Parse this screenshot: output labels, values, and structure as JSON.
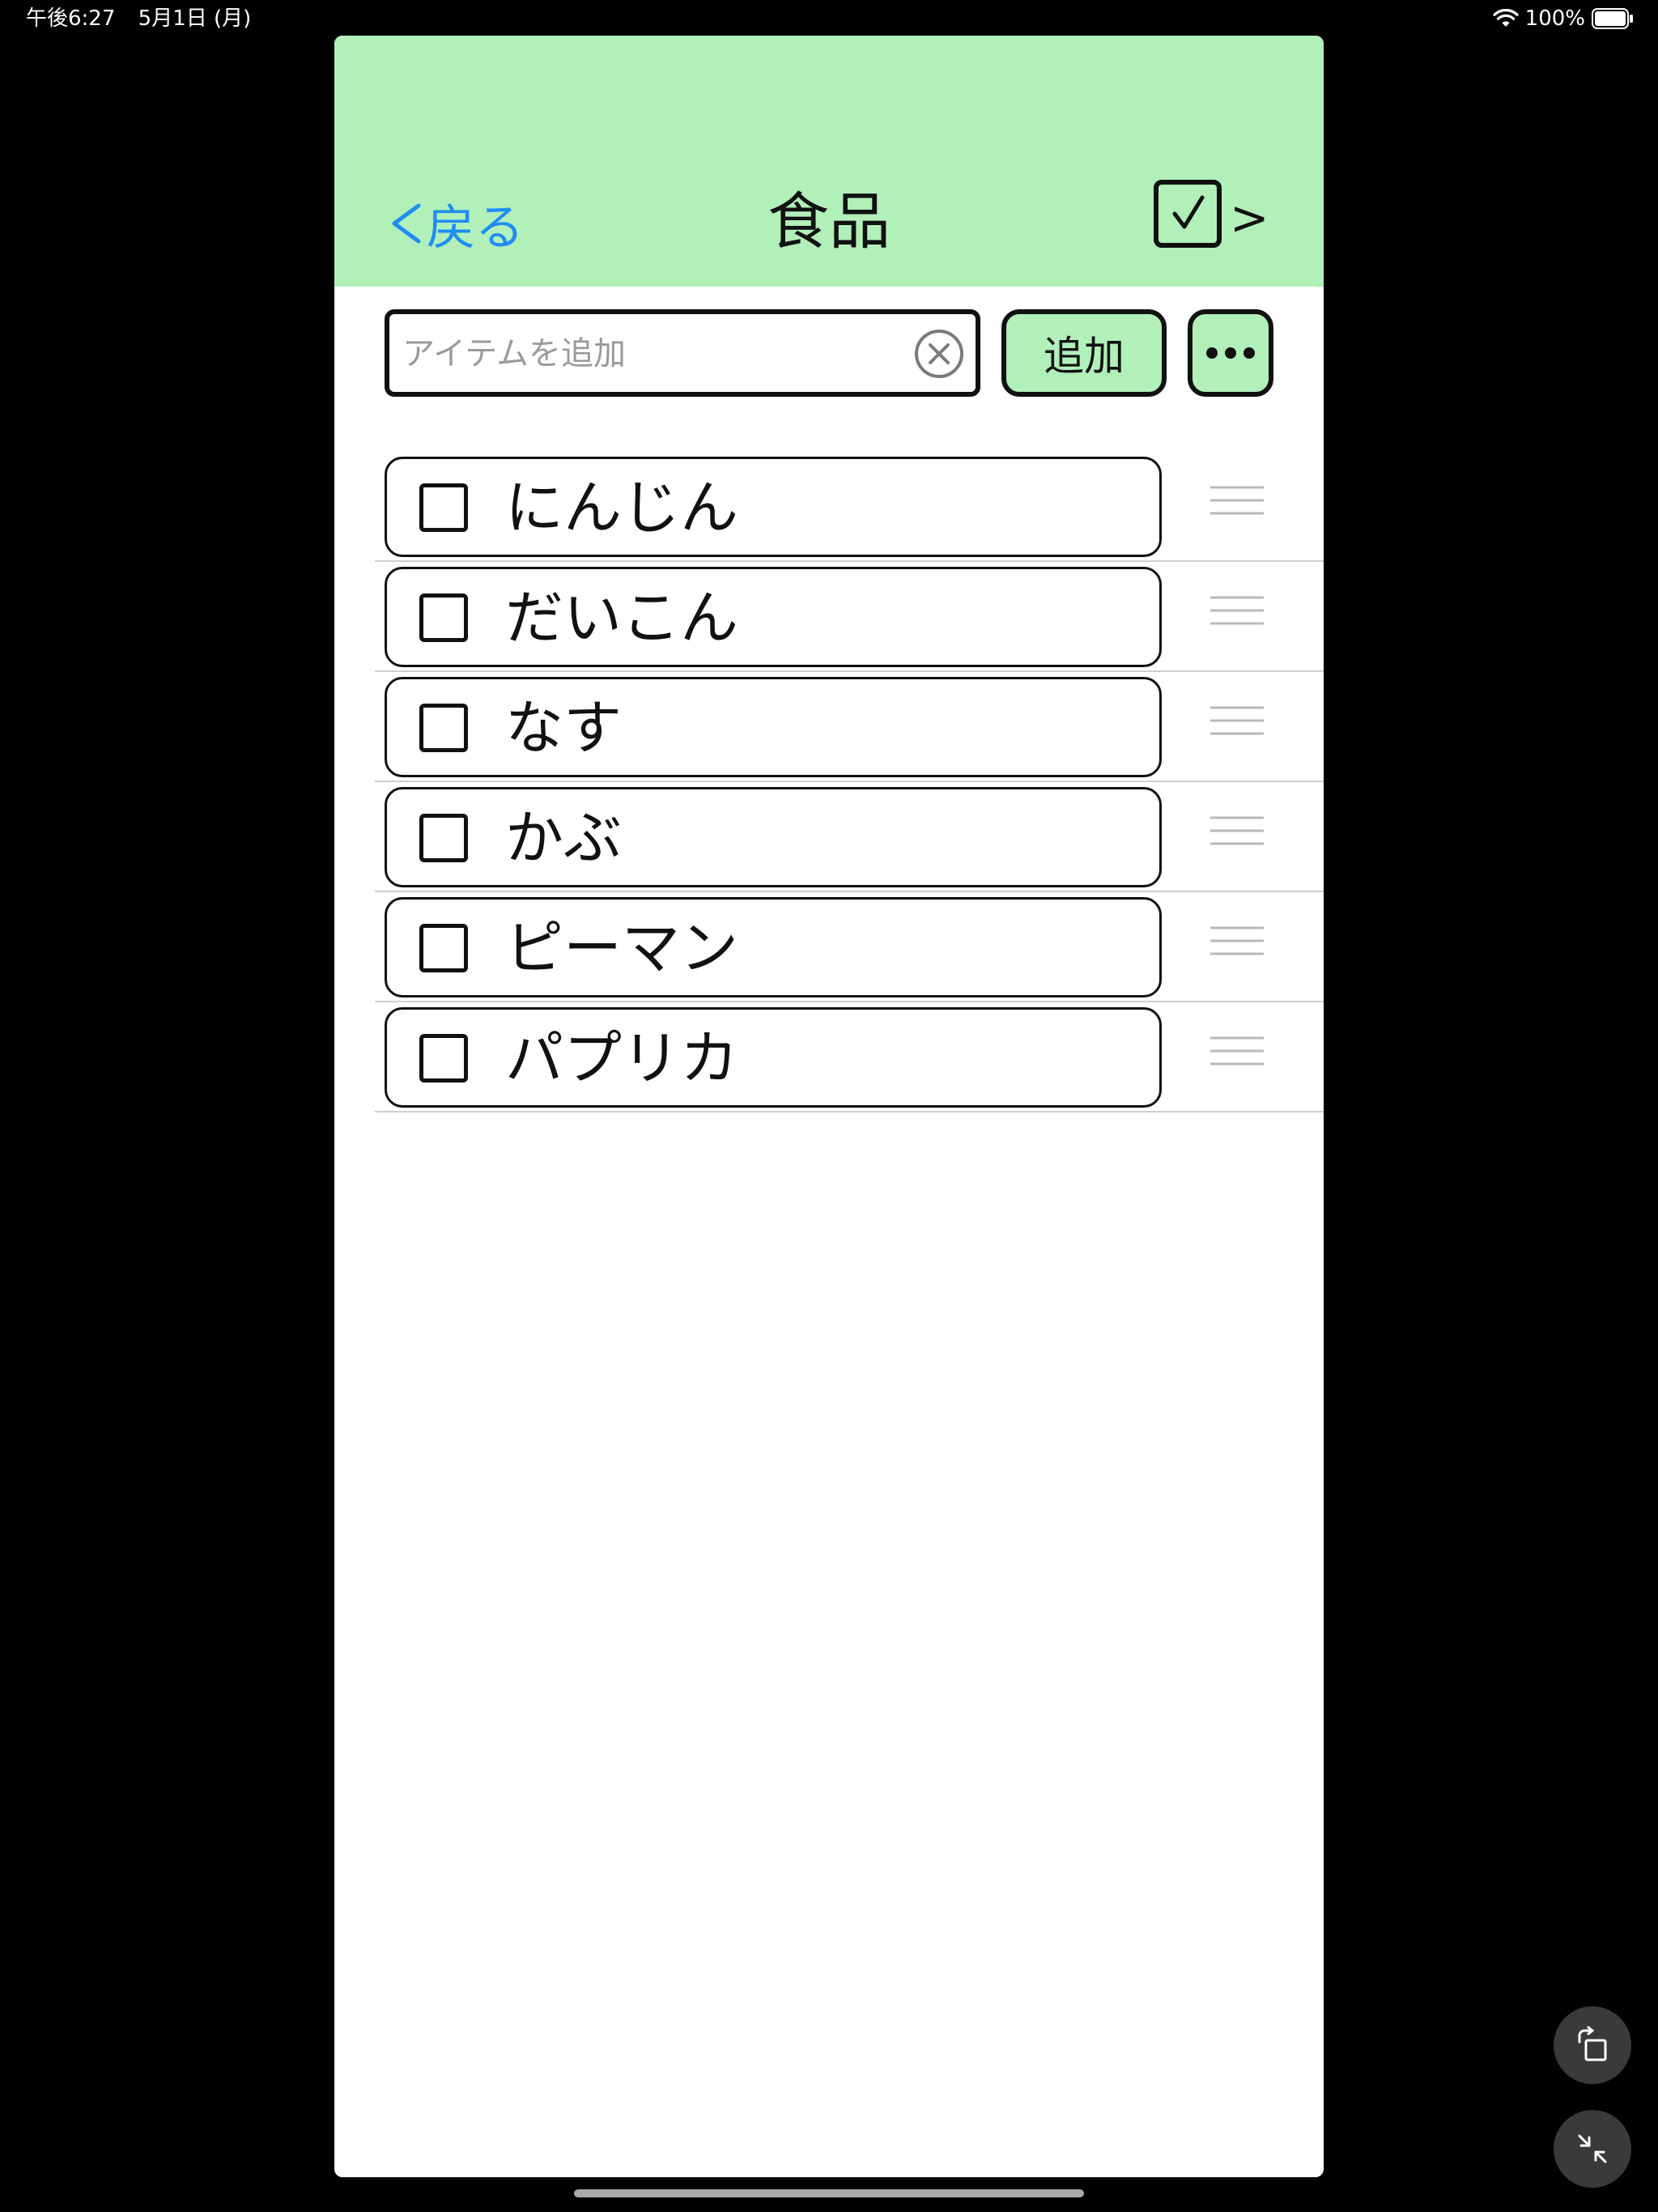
{
  "status_bar": {
    "time": "午後6:27",
    "date": "5月1日 (月)",
    "battery_percent": "100%",
    "battery_level": 1.0,
    "wifi_icon": "wifi-icon",
    "battery_icon": "battery-icon"
  },
  "header": {
    "back_label": "戻る",
    "title": "食品",
    "next_label": ">",
    "back_icon": "chevron-left-icon",
    "check_icon": "checkbox-checked-icon",
    "background_color": "#b1f0b9",
    "back_color": "#1f8df5"
  },
  "input_row": {
    "search_placeholder": "アイテムを追加",
    "search_value": "",
    "clear_icon": "clear-circle-icon",
    "add_label": "追加",
    "more_icon": "ellipsis-icon"
  },
  "items": [
    {
      "label": "にんじん",
      "checked": false
    },
    {
      "label": "だいこん",
      "checked": false
    },
    {
      "label": "なす",
      "checked": false
    },
    {
      "label": "かぶ",
      "checked": false
    },
    {
      "label": "ピーマン",
      "checked": false
    },
    {
      "label": "パプリカ",
      "checked": false
    }
  ],
  "system_controls": {
    "rotate_icon": "rotate-icon",
    "shrink_icon": "shrink-icon"
  }
}
